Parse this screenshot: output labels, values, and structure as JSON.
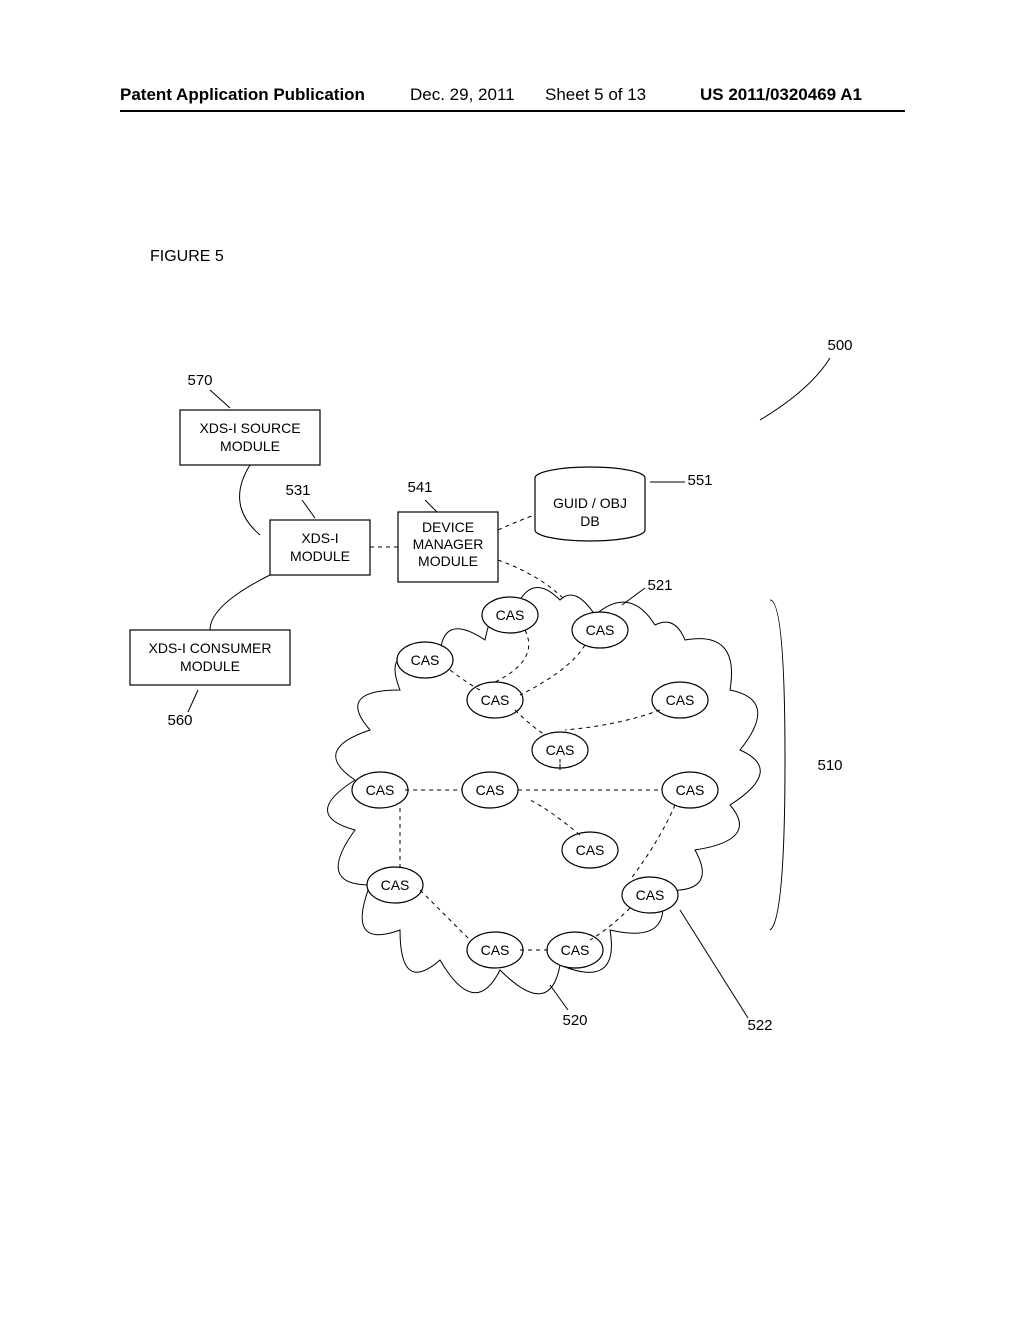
{
  "header": {
    "publication_label": "Patent Application Publication",
    "date": "Dec. 29, 2011",
    "sheet": "Sheet 5 of 13",
    "pubnum": "US 2011/0320469 A1"
  },
  "figure_label": "FIGURE 5",
  "refs": {
    "r500": "500",
    "r570": "570",
    "r531": "531",
    "r541": "541",
    "r551": "551",
    "r560": "560",
    "r521": "521",
    "r510": "510",
    "r520": "520",
    "r522": "522"
  },
  "boxes": {
    "xdsi_source_l1": "XDS-I SOURCE",
    "xdsi_source_l2": "MODULE",
    "xdsi_l1": "XDS-I",
    "xdsi_l2": "MODULE",
    "device_mgr_l1": "DEVICE",
    "device_mgr_l2": "MANAGER",
    "device_mgr_l3": "MODULE",
    "xdsi_consumer_l1": "XDS-I CONSUMER",
    "xdsi_consumer_l2": "MODULE"
  },
  "db": {
    "l1": "GUID / OBJ",
    "l2": "DB"
  },
  "cas_label": "CAS"
}
